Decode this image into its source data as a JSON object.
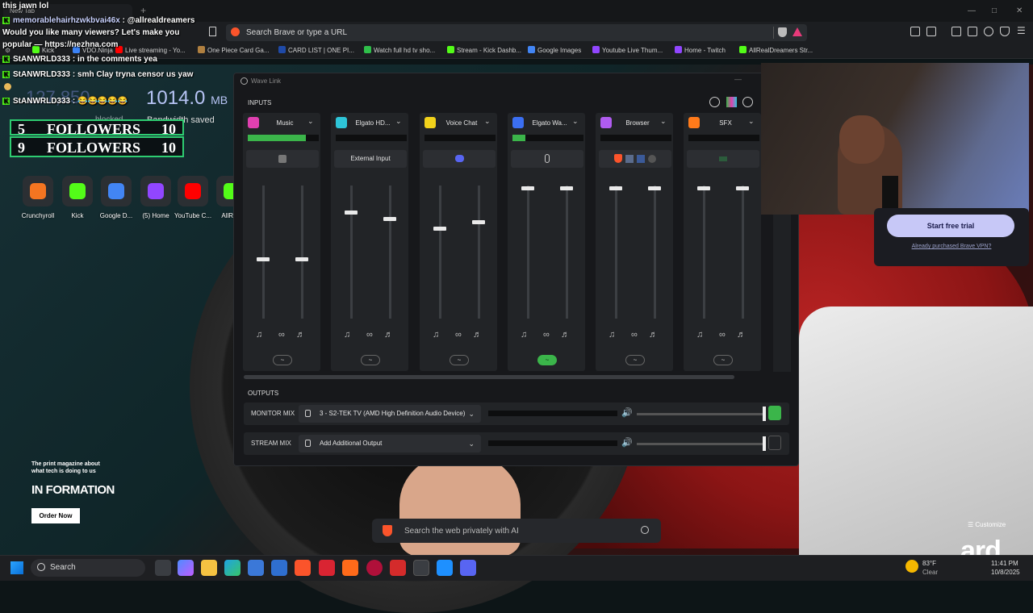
{
  "browser": {
    "new_tab_label": "New Tab",
    "address_placeholder": "Search Brave or type a URL",
    "bookmarks": [
      {
        "label": "Kick",
        "color": "#53fc18"
      },
      {
        "label": "VDO.Ninja",
        "color": "#3b82f6"
      },
      {
        "label": "Live streaming - Yo...",
        "color": "#ff0000"
      },
      {
        "label": "One Piece Card Ga...",
        "color": "#b08040"
      },
      {
        "label": "CARD LIST | ONE PI...",
        "color": "#1f4aa8"
      },
      {
        "label": "Watch full hd tv sho...",
        "color": "#2fbf4a"
      },
      {
        "label": "Stream - Kick Dashb...",
        "color": "#53fc18"
      },
      {
        "label": "Google Images",
        "color": "#4285f4"
      },
      {
        "label": "Youtube Live Thum...",
        "color": "#9146ff"
      },
      {
        "label": "Home - Twitch",
        "color": "#9146ff"
      },
      {
        "label": "AllRealDreamers Str...",
        "color": "#53fc18"
      }
    ]
  },
  "chat": {
    "top_line": "this jawn lol",
    "messages": [
      {
        "user": "memorablehairhzwkbvai46x",
        "text": ": @allrealdreamers"
      },
      {
        "user": "",
        "text": "Would you like many viewers? Let's make you"
      },
      {
        "user": "",
        "text": "popular — https://nezhna.com"
      },
      {
        "user": "StANWRLD333",
        "text": ": in the comments yea"
      },
      {
        "user": "StANWRLD333",
        "text": ": smh Clay tryna censor us yaw"
      },
      {
        "user": "StANWRLD333",
        "text": ": 😂😂😂😂😂"
      }
    ]
  },
  "stats": {
    "blocked_value": "127,850",
    "blocked_label": "blocked",
    "bandwidth_value": "1014.0",
    "bandwidth_unit": "MB",
    "bandwidth_label": "Bandwidth saved"
  },
  "followers": [
    {
      "left": "5",
      "label": "FOLLOWERS",
      "right": "10"
    },
    {
      "left": "9",
      "label": "FOLLOWERS",
      "right": "10"
    }
  ],
  "shortcuts": [
    {
      "label": "Crunchyroll",
      "color": "#f47521"
    },
    {
      "label": "Kick",
      "color": "#53fc18"
    },
    {
      "label": "Google D...",
      "color": "#4285f4"
    },
    {
      "label": "(5) Home",
      "color": "#9146ff"
    },
    {
      "label": "YouTube C...",
      "color": "#ff0000"
    },
    {
      "label": "AllReal",
      "color": "#53fc18"
    }
  ],
  "wavelink": {
    "title": "Wave Link",
    "inputs_label": "INPUTS",
    "outputs_label": "OUTPUTS",
    "channels": [
      {
        "name": "Music",
        "icon_color": "#e040b0",
        "meter": 0.82,
        "source": "app-icon",
        "source_text": "",
        "fader_left": 0.45,
        "fader_right": 0.45
      },
      {
        "name": "Elgato HD...",
        "icon_color": "#2ec5d8",
        "meter": 0.0,
        "source": "text",
        "source_text": "External Input",
        "fader_left": 0.8,
        "fader_right": 0.75
      },
      {
        "name": "Voice Chat",
        "icon_color": "#f2d21b",
        "meter": 0.0,
        "source": "discord-icon",
        "source_text": "",
        "fader_left": 0.68,
        "fader_right": 0.73
      },
      {
        "name": "Elgato Wa...",
        "icon_color": "#3b6ff2",
        "meter": 0.18,
        "source": "mic-icon",
        "source_text": "",
        "fader_left": 0.98,
        "fader_right": 0.98
      },
      {
        "name": "Browser",
        "icon_color": "#b05cf0",
        "meter": 0.0,
        "source": "browser-icons",
        "source_text": "",
        "fader_left": 0.98,
        "fader_right": 0.98
      },
      {
        "name": "SFX",
        "icon_color": "#ff7a1a",
        "meter": 0.0,
        "source": "sfx-icon",
        "source_text": "",
        "fader_left": 0.98,
        "fader_right": 0.98
      }
    ],
    "outputs": [
      {
        "label": "MONITOR MIX",
        "device": "3 - S2-TEK TV (AMD High Definition Audio Device)",
        "level": 1.0,
        "active": true
      },
      {
        "label": "STREAM MIX",
        "device": "Add Additional Output",
        "level": 1.0,
        "active": false
      }
    ]
  },
  "promo": {
    "button": "Start free trial",
    "link": "Already purchased Brave VPN?"
  },
  "ad": {
    "tagline": "The print magazine about what tech is doing to us",
    "brand": "IN FORMATION",
    "cta": "Order Now"
  },
  "newtab": {
    "search_placeholder": "Search the web privately with AI",
    "customize": "Customize"
  },
  "watermark": "ard.",
  "taskbar": {
    "search_label": "Search",
    "weather_temp": "83°F",
    "weather_desc": "Clear",
    "time": "11:41 PM",
    "date": "10/8/2025"
  }
}
